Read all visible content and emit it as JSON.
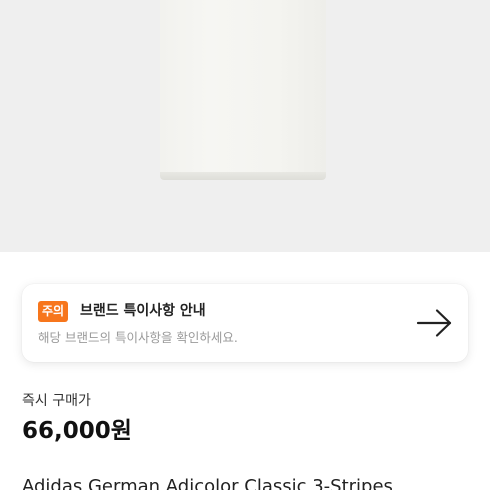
{
  "notice": {
    "badge": "주의",
    "title": "브랜드 특이사항 안내",
    "description": "해당 브랜드의 특이사항을 확인하세요.",
    "arrow_icon": "arrow-right-icon",
    "badge_color": "#f7761c"
  },
  "price": {
    "label": "즉시 구매가",
    "value": "66,000원"
  },
  "product": {
    "name": "Adidas German Adicolor Classic 3-Stripes"
  },
  "colors": {
    "image_background": "#efefef",
    "garment": "#f4f4f0"
  }
}
